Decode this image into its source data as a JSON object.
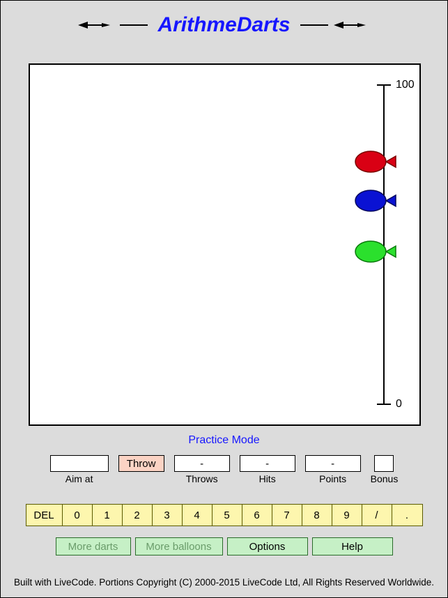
{
  "title": "ArithmeDarts",
  "scale": {
    "top_label": "100",
    "bottom_label": "0"
  },
  "balloons": [
    {
      "at": 76,
      "color": "#d90014",
      "stroke": "#7a0000"
    },
    {
      "at": 64,
      "color": "#0a12d3",
      "stroke": "#05085e"
    },
    {
      "at": 48,
      "color": "#2be02d",
      "stroke": "#0a7a0c"
    }
  ],
  "mode_label": "Practice Mode",
  "stats": {
    "aim_at": {
      "label": "Aim at",
      "value": ""
    },
    "throw_btn": "Throw",
    "throws": {
      "label": "Throws",
      "value": "-"
    },
    "hits": {
      "label": "Hits",
      "value": "-"
    },
    "points": {
      "label": "Points",
      "value": "-"
    },
    "bonus": {
      "label": "Bonus",
      "value": ""
    }
  },
  "keypad": [
    "DEL",
    "0",
    "1",
    "2",
    "3",
    "4",
    "5",
    "6",
    "7",
    "8",
    "9",
    "/",
    "."
  ],
  "controls": {
    "more_darts": "More darts",
    "more_balloons": "More balloons",
    "options": "Options",
    "help": "Help"
  },
  "footer": "Built with LiveCode. Portions Copyright (C) 2000-2015 LiveCode Ltd, All Rights Reserved Worldwide."
}
